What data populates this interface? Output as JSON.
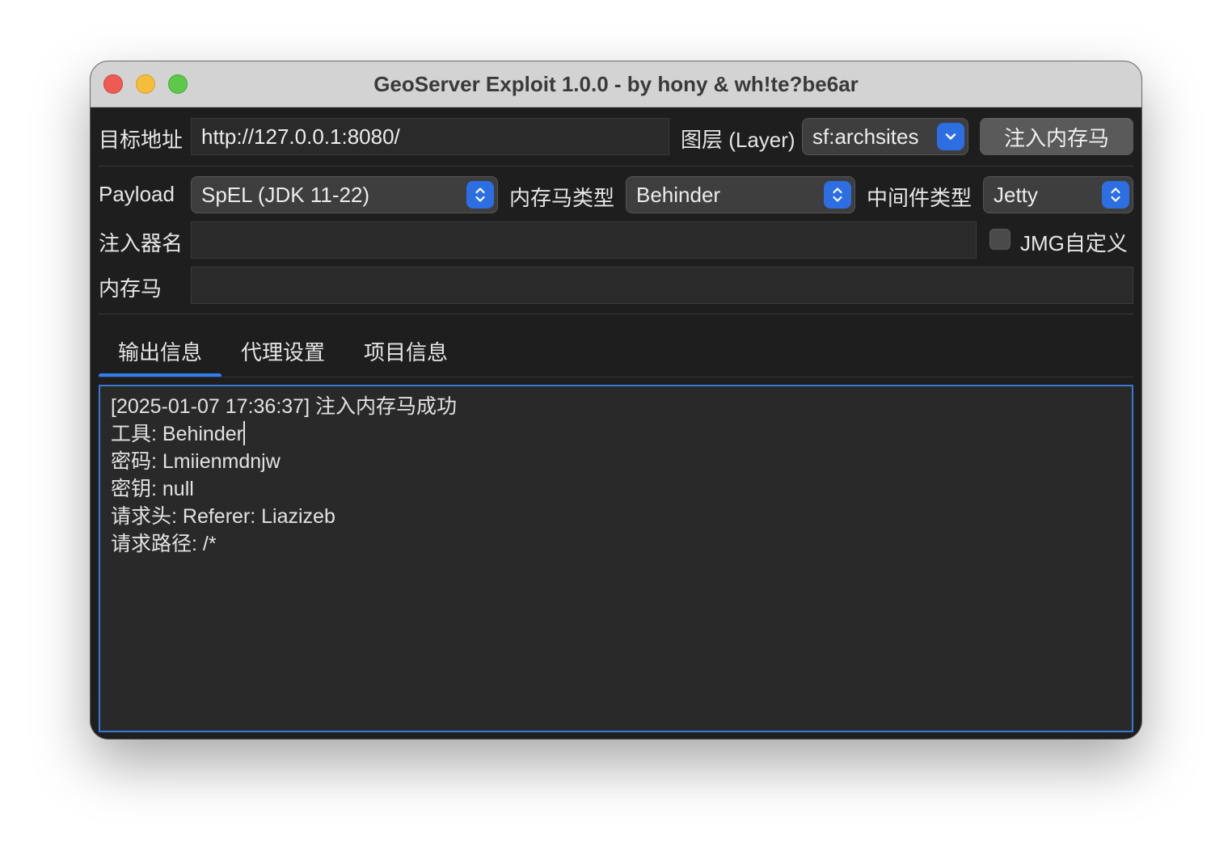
{
  "window": {
    "title": "GeoServer Exploit 1.0.0 - by hony & wh!te?be6ar"
  },
  "target": {
    "label": "目标地址",
    "url": "http://127.0.0.1:8080/",
    "layer_label": "图层 (Layer)",
    "layer_value": "sf:archsites",
    "inject_button": "注入内存马"
  },
  "options": {
    "payload_label": "Payload",
    "payload_value": "SpEL (JDK 11-22)",
    "shell_type_label": "内存马类型",
    "shell_type_value": "Behinder",
    "middleware_label": "中间件类型",
    "middleware_value": "Jetty",
    "injector_label": "注入器名",
    "injector_value": "",
    "jmg_label": "JMG自定义",
    "jmg_checked": false,
    "shell_label": "内存马",
    "shell_value": ""
  },
  "tabs": [
    {
      "label": "输出信息",
      "active": true
    },
    {
      "label": "代理设置",
      "active": false
    },
    {
      "label": "项目信息",
      "active": false
    }
  ],
  "output": {
    "lines": [
      "[2025-01-07 17:36:37] 注入内存马成功",
      "工具: Behinder",
      "密码: Lmiienmdnjw",
      "密钥: null",
      "请求头: Referer: Liazizeb",
      "请求路径: /*"
    ]
  },
  "colors": {
    "accent": "#2f7ff0",
    "window_bg": "#1e1e1e",
    "close": "#ee5b53",
    "minimize": "#f4be3c",
    "maximize": "#5fc84a"
  }
}
